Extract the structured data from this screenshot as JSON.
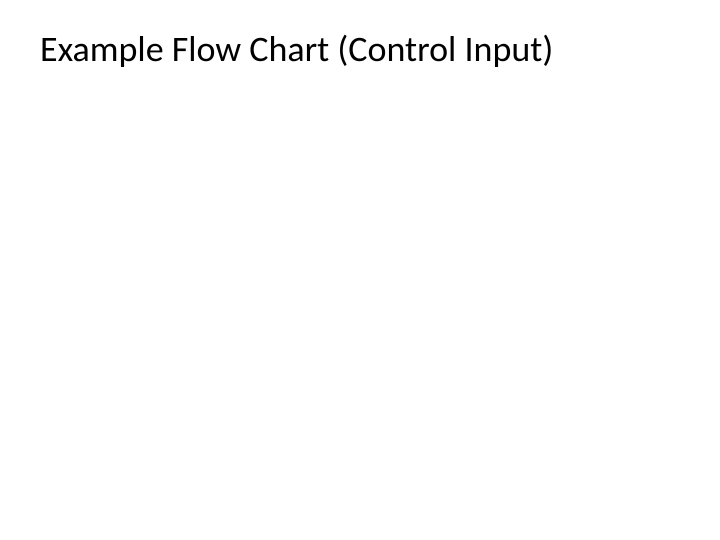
{
  "slide": {
    "title": "Example Flow Chart (Control Input)"
  }
}
